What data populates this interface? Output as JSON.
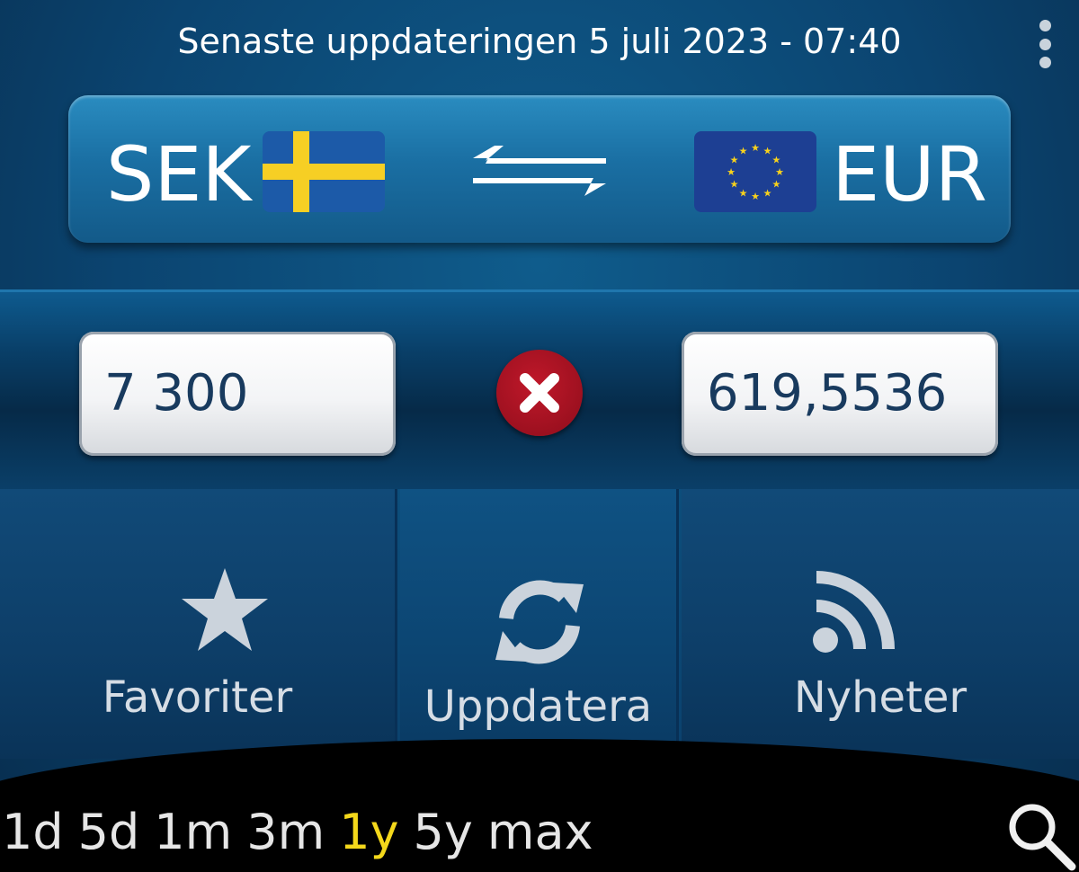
{
  "header": {
    "last_updated": "Senaste uppdateringen 5 juli 2023 - 07:40",
    "menu_icon": "overflow-menu-icon"
  },
  "converter": {
    "from_currency": "SEK",
    "to_currency": "EUR",
    "from_flag": "sweden-flag-icon",
    "to_flag": "eu-flag-icon",
    "swap_icon": "swap-arrows-icon",
    "amount_from": "7 300",
    "amount_to": "619,5536",
    "clear_icon": "clear-x-icon"
  },
  "nav": {
    "favorites_label": "Favoriter",
    "update_label": "Uppdatera",
    "news_label": "Nyheter"
  },
  "periods": {
    "items": [
      "1d",
      "5d",
      "1m",
      "3m",
      "1y",
      "5y",
      "max"
    ],
    "active": "1y"
  },
  "colors": {
    "accent_active_period": "#f4d81b",
    "clear_button": "#b0121f",
    "background": "#0b4470"
  }
}
